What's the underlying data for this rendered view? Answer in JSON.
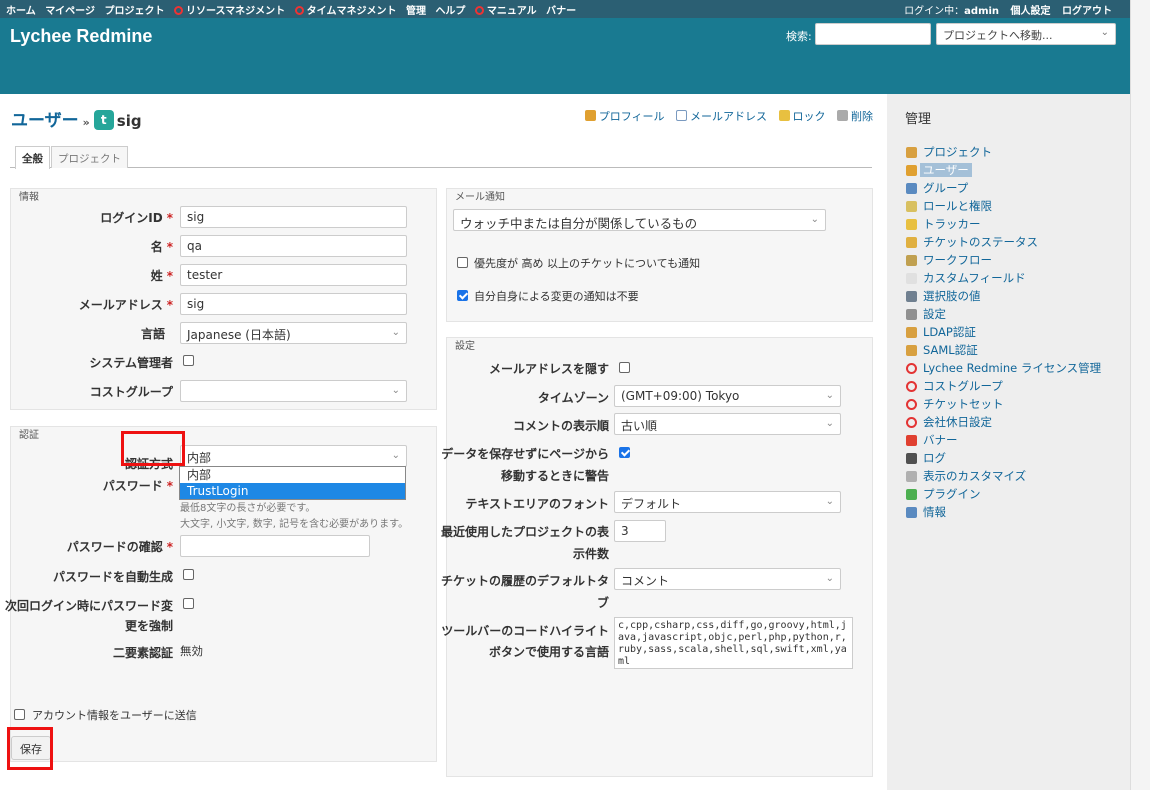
{
  "top_menu": {
    "left": [
      "ホーム",
      "マイページ",
      "プロジェクト",
      "リソースマネジメント",
      "タイムマネジメント",
      "管理",
      "ヘルプ",
      "マニュアル",
      "バナー"
    ],
    "login_label": "ログイン中：",
    "login_user": "admin",
    "my_account": "個人設定",
    "logout": "ログアウト"
  },
  "header": {
    "title": "Lychee Redmine",
    "search_label": "検索:",
    "search_value": "",
    "jump_label": "プロジェクトへ移動..."
  },
  "page": {
    "title": "ユーザー",
    "sep": "»",
    "avatar_letter": "t",
    "user_name": "sig",
    "actions": {
      "profile": "プロフィール",
      "mail": "メールアドレス",
      "lock": "ロック",
      "delete": "削除"
    },
    "tabs": [
      "全般",
      "プロジェクト"
    ]
  },
  "info": {
    "legend": "情報",
    "login_label": "ログインID",
    "login_value": "sig",
    "first_label": "名",
    "first_value": "qa",
    "last_label": "姓",
    "last_value": "tester",
    "mail_label": "メールアドレス",
    "mail_value": "sig",
    "lang_label": "言語",
    "lang_value": "Japanese (日本語)",
    "admin_label": "システム管理者",
    "cost_label": "コストグループ",
    "cost_value": ""
  },
  "auth": {
    "legend": "認証",
    "mode_label": "認証方式",
    "mode_value": "内部",
    "options": [
      "内部",
      "TrustLogin"
    ],
    "password_label": "パスワード",
    "pw_note1": "最低8文字の長さが必要です。",
    "pw_note2": "大文字, 小文字, 数字, 記号を含む必要があります。",
    "confirm_label": "パスワードの確認",
    "generate_label": "パスワードを自動生成",
    "force_label1": "次回ログイン時にパスワード変",
    "force_label2": "更を強制",
    "twofa_label": "二要素認証",
    "twofa_value": "無効"
  },
  "mail": {
    "legend": "メール通知",
    "select_value": "ウォッチ中または自分が関係しているもの",
    "high_prio": "優先度が 高め 以上のチケットについても通知",
    "no_self": "自分自身による変更の通知は不要"
  },
  "prefs": {
    "legend": "設定",
    "hide_mail_label": "メールアドレスを隠す",
    "tz_label": "タイムゾーン",
    "tz_value": "(GMT+09:00) Tokyo",
    "comments_label": "コメントの表示順",
    "comments_value": "古い順",
    "warn_label1": "データを保存せずにページから",
    "warn_label2": "移動するときに警告",
    "font_label": "テキストエリアのフォント",
    "font_value": "デフォルト",
    "recent_label1": "最近使用したプロジェクトの表",
    "recent_label2": "示件数",
    "recent_value": "3",
    "history_label1": "チケットの履歴のデフォルトタ",
    "history_label2": "ブ",
    "history_value": "コメント",
    "toolbar_label1": "ツールバーのコードハイライト",
    "toolbar_label2": "ボタンで使用する言語",
    "toolbar_value": "c,cpp,csharp,css,diff,go,groovy,html,java,javascript,objc,perl,php,python,r,ruby,sass,scala,shell,sql,swift,xml,yaml"
  },
  "footer": {
    "send_info": "アカウント情報をユーザーに送信",
    "save": "保存"
  },
  "sidebar": {
    "title": "管理",
    "items": [
      {
        "label": "プロジェクト",
        "color": "#d8a040"
      },
      {
        "label": "ユーザー",
        "color": "#e0a030"
      },
      {
        "label": "グループ",
        "color": "#5a8ac0"
      },
      {
        "label": "ロールと権限",
        "color": "#d8c060"
      },
      {
        "label": "トラッカー",
        "color": "#e8c040"
      },
      {
        "label": "チケットのステータス",
        "color": "#e0b040"
      },
      {
        "label": "ワークフロー",
        "color": "#c0a050"
      },
      {
        "label": "カスタムフィールド",
        "color": "#e0e0e0"
      },
      {
        "label": "選択肢の値",
        "color": "#708090"
      },
      {
        "label": "設定",
        "color": "#909090"
      },
      {
        "label": "LDAP認証",
        "color": "#d8a040"
      },
      {
        "label": "SAML認証",
        "color": "#d8a040"
      },
      {
        "label": "Lychee Redmine ライセンス管理",
        "color": "#e33333"
      },
      {
        "label": "コストグループ",
        "color": "#e33333"
      },
      {
        "label": "チケットセット",
        "color": "#e33333"
      },
      {
        "label": "会社休日設定",
        "color": "#e33333"
      },
      {
        "label": "バナー",
        "color": "#e04030"
      },
      {
        "label": "ログ",
        "color": "#505050"
      },
      {
        "label": "表示のカスタマイズ",
        "color": "#b0b0b0"
      },
      {
        "label": "プラグイン",
        "color": "#4caf50"
      },
      {
        "label": "情報",
        "color": "#5a8ac0"
      }
    ]
  }
}
